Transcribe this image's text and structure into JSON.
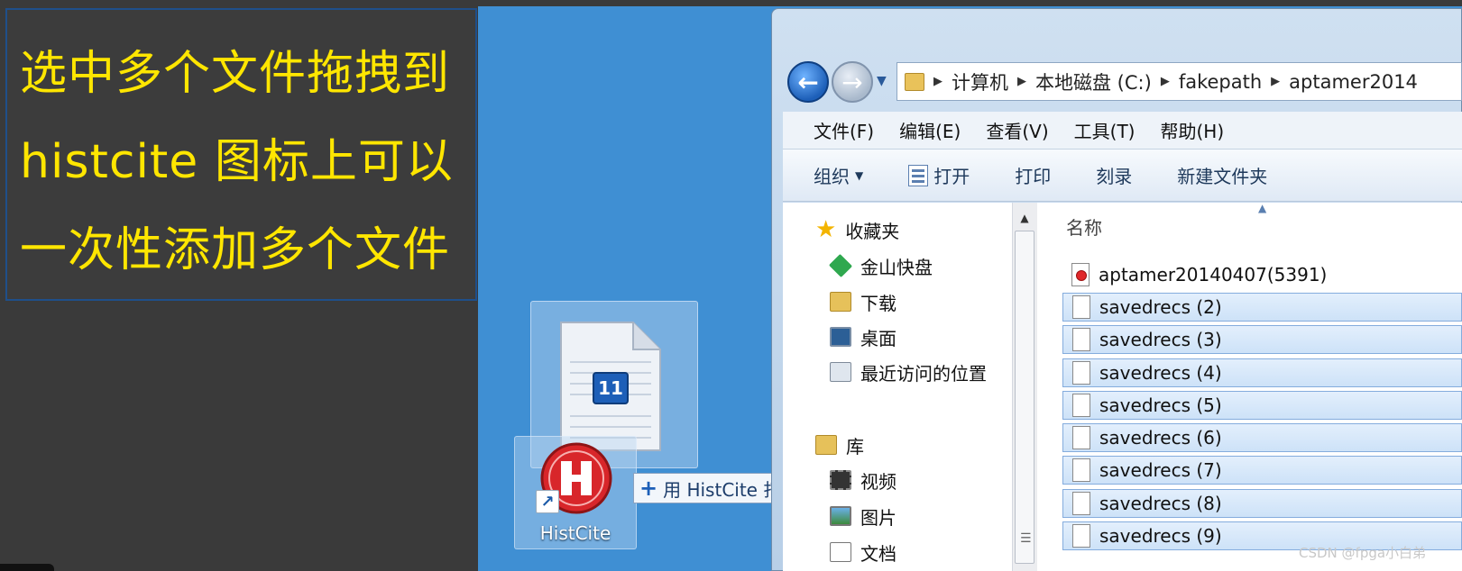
{
  "annotation": {
    "lines": [
      "选中多个文件拖拽到",
      "histcite 图标上可以",
      "一次性添加多个文件"
    ],
    "text_color": "#ffe600"
  },
  "desktop": {
    "background": "#3f8fd3",
    "histcite_icon_label": "HistCite",
    "ghost_badge": "11",
    "drag_tooltip": "用 HistCite 打开"
  },
  "explorer": {
    "address": [
      "计算机",
      "本地磁盘 (C:)",
      "fakepath",
      "aptamer2014"
    ],
    "menu": [
      "文件(F)",
      "编辑(E)",
      "查看(V)",
      "工具(T)",
      "帮助(H)"
    ],
    "toolbar": {
      "organize": "组织",
      "open": "打开",
      "print": "打印",
      "burn": "刻录",
      "new_folder": "新建文件夹"
    },
    "nav": {
      "favorites": "收藏夹",
      "items": [
        "金山快盘",
        "下载",
        "桌面",
        "最近访问的位置"
      ],
      "libraries": "库",
      "lib_items": [
        "视频",
        "图片",
        "文档"
      ]
    },
    "column_name": "名称",
    "files": [
      {
        "name": "aptamer20140407(5391)",
        "selected": false,
        "icon": "rec-file-icon"
      },
      {
        "name": "savedrecs (2)",
        "selected": true,
        "icon": "file-icon"
      },
      {
        "name": "savedrecs (3)",
        "selected": true,
        "icon": "file-icon"
      },
      {
        "name": "savedrecs (4)",
        "selected": true,
        "icon": "file-icon"
      },
      {
        "name": "savedrecs (5)",
        "selected": true,
        "icon": "file-icon"
      },
      {
        "name": "savedrecs (6)",
        "selected": true,
        "icon": "file-icon"
      },
      {
        "name": "savedrecs (7)",
        "selected": true,
        "icon": "file-icon"
      },
      {
        "name": "savedrecs (8)",
        "selected": true,
        "icon": "file-icon"
      },
      {
        "name": "savedrecs (9)",
        "selected": true,
        "icon": "file-icon"
      }
    ]
  },
  "watermark": "CSDN @fpga小白弟"
}
